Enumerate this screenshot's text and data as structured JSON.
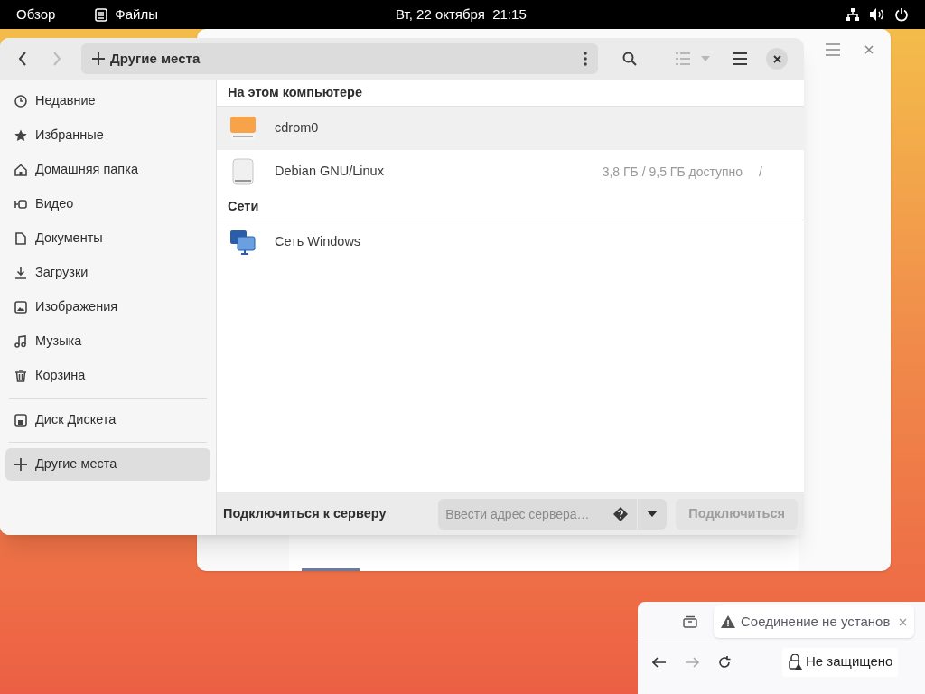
{
  "top_bar": {
    "activities": "Обзор",
    "app_name": "Файлы",
    "clock": "Вт, 22 октября  21:15"
  },
  "files_window": {
    "path": "Другие места",
    "back_disabled": false,
    "forward_disabled": true,
    "sidebar": [
      {
        "label": "Недавние",
        "selected": false
      },
      {
        "label": "Избранные",
        "selected": false
      },
      {
        "label": "Домашняя папка",
        "selected": false
      },
      {
        "label": "Видео",
        "selected": false
      },
      {
        "label": "Документы",
        "selected": false
      },
      {
        "label": "Загрузки",
        "selected": false
      },
      {
        "label": "Изображения",
        "selected": false
      },
      {
        "label": "Музыка",
        "selected": false
      },
      {
        "label": "Корзина",
        "selected": false
      },
      {
        "label": "Диск Дискета",
        "selected": false
      },
      {
        "label": "Другие места",
        "selected": true
      }
    ],
    "sections": [
      {
        "title": "На этом компьютере",
        "items": [
          {
            "name": "cdrom0",
            "kind": "cdrom",
            "highlighted": true
          },
          {
            "name": "Debian GNU/Linux",
            "kind": "disk",
            "highlighted": false,
            "usage": "3,8 ГБ / 9,5 ГБ доступно",
            "mount": "/"
          }
        ]
      },
      {
        "title": "Сети",
        "items": [
          {
            "name": "Сеть Windows",
            "kind": "network",
            "highlighted": false
          }
        ]
      }
    ],
    "connect": {
      "label": "Подключиться к серверу",
      "placeholder": "Ввести адрес сервера…",
      "button": "Подключиться",
      "button_disabled": true
    }
  },
  "browser_window": {
    "tab_title": "Соединение не установ",
    "security": "Не защищено"
  }
}
